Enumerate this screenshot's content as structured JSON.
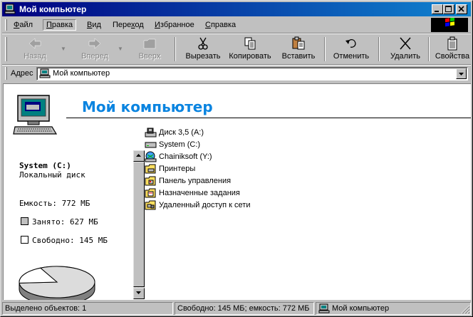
{
  "window": {
    "title": "Мой компьютер",
    "controls": [
      "minimize",
      "maximize",
      "close"
    ]
  },
  "menu": {
    "items": [
      {
        "label": "Файл",
        "accel": "Ф"
      },
      {
        "label": "Правка",
        "accel": "П"
      },
      {
        "label": "Вид",
        "accel": "В"
      },
      {
        "label": "Переход",
        "accel": "х"
      },
      {
        "label": "Избранное",
        "accel": "И"
      },
      {
        "label": "Справка",
        "accel": "С"
      }
    ],
    "active_index": 1
  },
  "toolbar": {
    "back": "Назад",
    "forward": "Вперед",
    "up": "Вверх",
    "cut": "Вырезать",
    "copy": "Копировать",
    "paste": "Вставить",
    "undo": "Отменить",
    "delete": "Удалить",
    "properties": "Свойства"
  },
  "address": {
    "label": "Адрес",
    "value": "Мой компьютер"
  },
  "content": {
    "title": "Мой компьютер",
    "drive_name": "System (C:)",
    "drive_type": "Локальный диск",
    "capacity": "Емкость: 772 МБ",
    "used": "Занято: 627 МБ",
    "free": "Свободно: 145 МБ",
    "used_fraction": 0.812,
    "used_color": "#c0c0c0",
    "free_color": "#ffffff",
    "title_color": "#0a84e0"
  },
  "files": [
    {
      "name": "Диск 3,5 (A:)",
      "icon": "floppy-drive-icon"
    },
    {
      "name": "System (C:)",
      "icon": "hard-drive-icon"
    },
    {
      "name": "Chainiksoft (Y:)",
      "icon": "network-drive-icon"
    },
    {
      "name": "Принтеры",
      "icon": "printers-folder-icon"
    },
    {
      "name": "Панель управления",
      "icon": "control-panel-folder-icon"
    },
    {
      "name": "Назначенные задания",
      "icon": "scheduled-tasks-folder-icon"
    },
    {
      "name": "Удаленный доступ к сети",
      "icon": "dialup-folder-icon"
    }
  ],
  "status": {
    "selected": "Выделено объектов: 1",
    "space": "Свободно: 145 МБ;  емкость: 772 МБ",
    "location": "Мой компьютер"
  }
}
